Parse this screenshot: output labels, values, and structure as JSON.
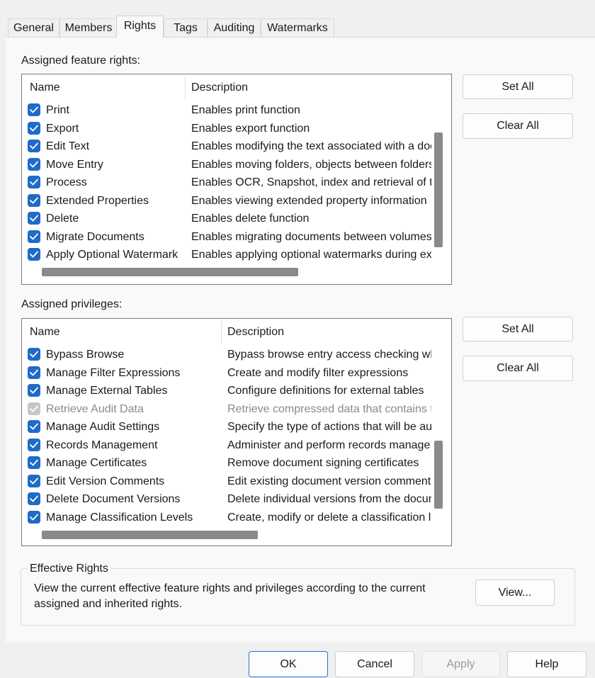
{
  "tabs": [
    {
      "label": "General"
    },
    {
      "label": "Members"
    },
    {
      "label": "Rights",
      "active": true
    },
    {
      "label": "Tags"
    },
    {
      "label": "Auditing"
    },
    {
      "label": "Watermarks"
    }
  ],
  "feature_rights": {
    "label": "Assigned feature rights:",
    "columns": {
      "name": "Name",
      "description": "Description"
    },
    "rows": [
      {
        "name": "Print",
        "description": "Enables print function",
        "checked": true
      },
      {
        "name": "Export",
        "description": "Enables export function",
        "checked": true
      },
      {
        "name": "Edit Text",
        "description": "Enables modifying the text associated with a doc",
        "checked": true
      },
      {
        "name": "Move Entry",
        "description": "Enables moving folders, objects between folders",
        "checked": true
      },
      {
        "name": "Process",
        "description": "Enables OCR, Snapshot, index and retrieval of te",
        "checked": true
      },
      {
        "name": "Extended Properties",
        "description": "Enables viewing extended property information",
        "checked": true
      },
      {
        "name": "Delete",
        "description": "Enables delete function",
        "checked": true
      },
      {
        "name": "Migrate Documents",
        "description": "Enables migrating documents between volumes",
        "checked": true
      },
      {
        "name": "Apply Optional Watermark",
        "description": "Enables applying optional watermarks during ex",
        "checked": true
      }
    ],
    "set_all_label": "Set All",
    "clear_all_label": "Clear All"
  },
  "privileges": {
    "label": "Assigned privileges:",
    "columns": {
      "name": "Name",
      "description": "Description"
    },
    "rows": [
      {
        "name": "Bypass Browse",
        "description": "Bypass browse entry access checking wh",
        "checked": true
      },
      {
        "name": "Manage Filter Expressions",
        "description": "Create and modify filter expressions",
        "checked": true
      },
      {
        "name": "Manage External Tables",
        "description": "Configure definitions for external tables",
        "checked": true
      },
      {
        "name": "Retrieve Audit Data",
        "description": "Retrieve compressed data that contains t",
        "checked": true,
        "disabled": true
      },
      {
        "name": "Manage Audit Settings",
        "description": "Specify the type of actions that will be auc",
        "checked": true
      },
      {
        "name": "Records Management",
        "description": "Administer and perform records manage",
        "checked": true
      },
      {
        "name": "Manage Certificates",
        "description": "Remove document signing certificates",
        "checked": true
      },
      {
        "name": "Edit Version Comments",
        "description": "Edit existing document version comments",
        "checked": true
      },
      {
        "name": "Delete Document Versions",
        "description": "Delete individual versions from the docun",
        "checked": true
      },
      {
        "name": "Manage Classification Levels",
        "description": "Create, modify or delete a classification le",
        "checked": true
      }
    ],
    "set_all_label": "Set All",
    "clear_all_label": "Clear All"
  },
  "effective_rights": {
    "legend": "Effective Rights",
    "text_line1": "View the current effective feature rights and privileges according to the current",
    "text_line2": "assigned and inherited rights.",
    "view_label": "View..."
  },
  "footer": {
    "ok": "OK",
    "cancel": "Cancel",
    "apply": "Apply",
    "help": "Help"
  },
  "colors": {
    "accent": "#1f6bc9",
    "disabled_check": "#c6c6c6"
  }
}
